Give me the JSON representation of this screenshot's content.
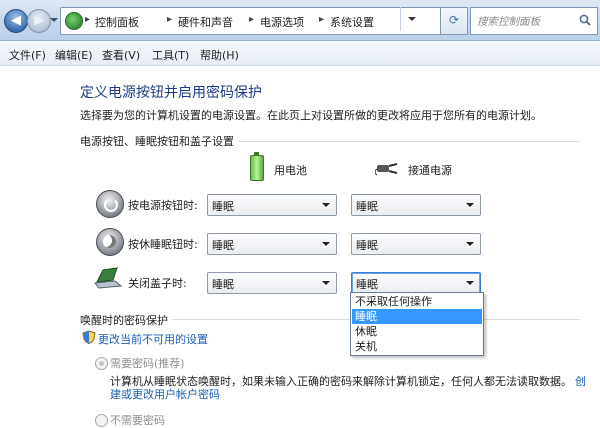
{
  "search": {
    "placeholder": "搜索控制面板"
  },
  "breadcrumb": {
    "items": [
      "控制面板",
      "硬件和声音",
      "电源选项",
      "系统设置"
    ]
  },
  "menu": {
    "items": [
      "文件(F)",
      "编辑(E)",
      "查看(V)",
      "工具(T)",
      "帮助(H)"
    ]
  },
  "page": {
    "title": "定义电源按钮并启用密码保护",
    "description": "选择要为您的计算机设置的电源设置。在此页上对设置所做的更改将应用于您所有的电源计划。"
  },
  "buttons_section": {
    "title": "电源按钮、睡眠按钮和盖子设置",
    "col_battery": "用电池",
    "col_plugged": "接通电源",
    "rows": [
      {
        "label": "按电源按钮时:",
        "battery": "睡眠",
        "plugged": "睡眠"
      },
      {
        "label": "按休睡眠钮时:",
        "battery": "睡眠",
        "plugged": "睡眠"
      },
      {
        "label": "关闭盖子时:",
        "battery": "睡眠",
        "plugged": "睡眠"
      }
    ],
    "dropdown_options": [
      "不采取任何操作",
      "睡眠",
      "休眠",
      "关机"
    ],
    "dropdown_selected_index": 1
  },
  "password_section": {
    "title": "唤醒时的密码保护",
    "change_link": "更改当前不可用的设置",
    "option_required": "需要密码(推荐)",
    "required_desc_1": "计算机从睡眠状态唤醒时，如果未输入正确的密码来解除计算机锁定，任何人都无法读取数据。",
    "required_link_1": "创",
    "required_link_2": "建或更改用户帐户密码",
    "option_not_required": "不需要密码"
  },
  "colors": {
    "accent": "#1e3a8a",
    "link": "#1a5fb4",
    "selection": "#3399ff"
  }
}
